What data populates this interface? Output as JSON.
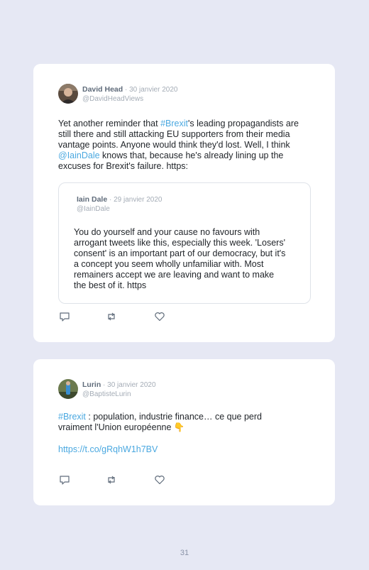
{
  "tweets": [
    {
      "author": "David Head",
      "date": "· 30 janvier 2020",
      "handle": "@DavidHeadViews",
      "body": {
        "t1": "Yet another reminder that ",
        "h1": "#Brexit",
        "t2": "'s leading propagandists are still there and still attacking EU supporters from their media vantage points. Anyone would think they'd lost. Well, I think ",
        "m1": "@IainDale",
        "t3": " knows that, because he's already lining up the excuses for Brexit's failure. https:"
      },
      "quoted": {
        "author": "Iain Dale",
        "date": "· 29 janvier 2020",
        "handle": "@IainDale",
        "body": "You do yourself and your cause no favours with arrogant tweets like this, especially this week. 'Losers' consent' is an important part of our democracy, but it's a concept you seem wholly unfamiliar with. Most remainers accept we are leaving and want to make the best of it. https"
      },
      "actions": [
        "reply-icon",
        "retweet-icon",
        "like-icon"
      ]
    },
    {
      "author": "Lurin",
      "date": "· 30 janvier 2020",
      "handle": "@BaptisteLurin",
      "body": {
        "h1": "#Brexit",
        "t1": " : population, industrie finance… ce que perd vraiment l'Union européenne 👇",
        "url": "https://t.co/gRqhW1h7BV"
      },
      "actions": [
        "reply-icon",
        "retweet-icon",
        "like-icon"
      ]
    }
  ],
  "page_number": "31",
  "colors": {
    "background": "#e6e8f4",
    "card": "#ffffff",
    "link": "#4aa8e0",
    "muted": "#a4acb6"
  }
}
